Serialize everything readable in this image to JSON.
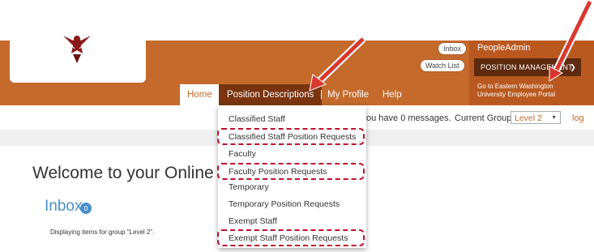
{
  "header": {
    "inbox_pill": "Inbox",
    "watchlist_pill": "Watch List",
    "brand": "PeopleAdmin",
    "module_button": "POSITION MANAGEMENT",
    "ewu_link": "Go to Eastern Washington University Employee Portal"
  },
  "nav": {
    "home": "Home",
    "position_descriptions": "Position Descriptions",
    "separator": "|",
    "my_profile": "My Profile",
    "help": "Help"
  },
  "status": {
    "messages": "ou have 0 messages.",
    "group_label": "Current Group:",
    "group_value": "Level 2",
    "logout_partial": "log"
  },
  "main": {
    "welcome": "Welcome to your Online Re",
    "inbox_title": "Inbox",
    "inbox_count": "0",
    "displaying": "Displaying items for group \"Level 2\"."
  },
  "dropdown": {
    "items": [
      "Classified Staff",
      "Classified Staff Position Requests",
      "Faculty",
      "Faculty Position Requests",
      "Temporary",
      "Temporary Position Requests",
      "Exempt Staff",
      "Exempt Staff Position Requests"
    ]
  },
  "colors": {
    "brand_orange": "#c46a2c",
    "dark_brown": "#5e2a10",
    "highlight_red": "#c0102a",
    "inbox_blue": "#4a90c8"
  }
}
